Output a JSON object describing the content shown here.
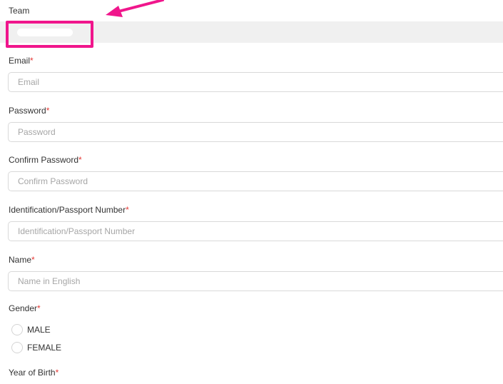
{
  "team": {
    "label": "Team"
  },
  "email": {
    "label": "Email",
    "required": "*",
    "placeholder": "Email"
  },
  "password": {
    "label": "Password",
    "required": "*",
    "placeholder": "Password"
  },
  "confirm_password": {
    "label": "Confirm Password",
    "required": "*",
    "placeholder": "Confirm Password"
  },
  "id_number": {
    "label": "Identification/Passport Number",
    "required": "*",
    "placeholder": "Identification/Passport Number"
  },
  "name": {
    "label": "Name",
    "required": "*",
    "placeholder": "Name in English"
  },
  "gender": {
    "label": "Gender",
    "required": "*",
    "options": [
      "MALE",
      "FEMALE"
    ]
  },
  "year_of_birth": {
    "label": "Year of Birth",
    "required": "*"
  },
  "annotation": {
    "color": "#f0168c"
  }
}
